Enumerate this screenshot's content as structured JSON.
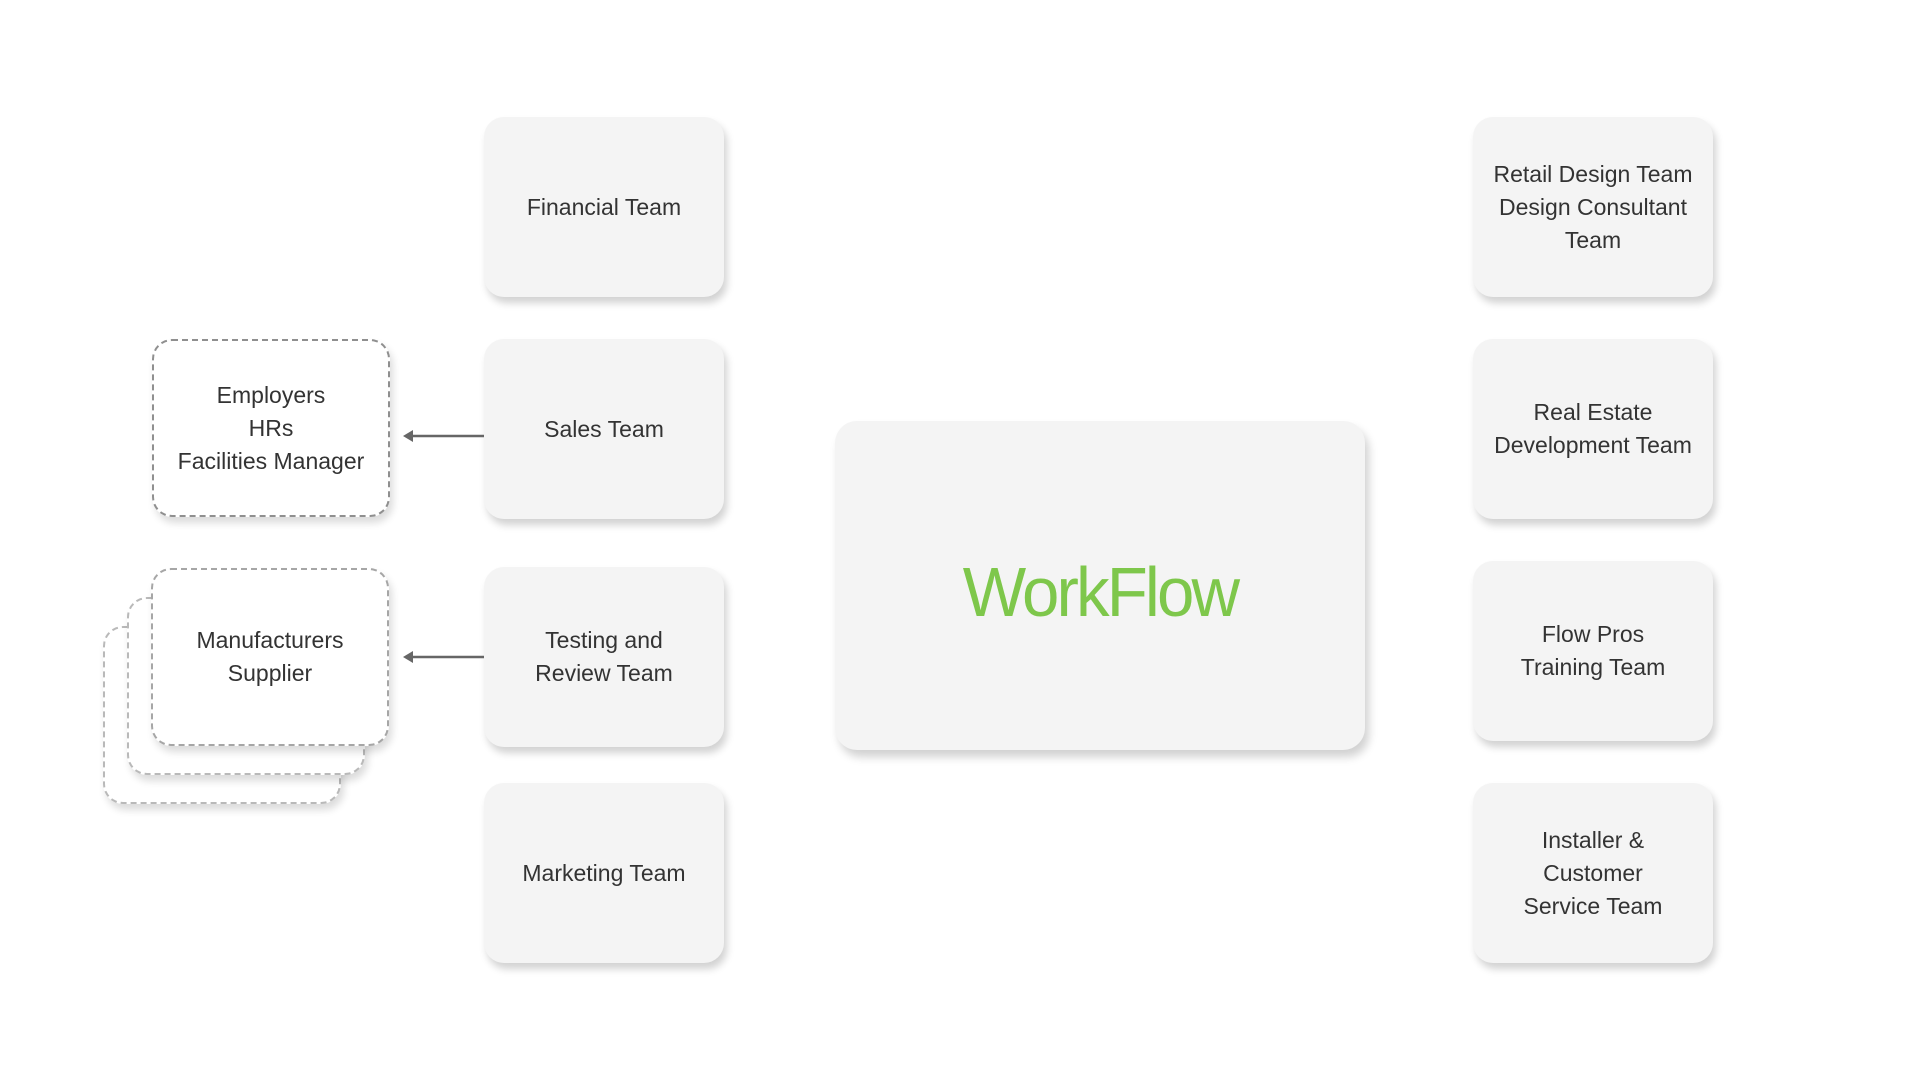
{
  "diagram": {
    "brand": {
      "name": "WorkFlow",
      "color": "#7ec74b"
    },
    "left_teams": [
      {
        "id": "financial",
        "label": "Financial Team"
      },
      {
        "id": "sales",
        "label": "Sales Team"
      },
      {
        "id": "testing",
        "label": "Testing and\nReview Team"
      },
      {
        "id": "marketing",
        "label": "Marketing Team"
      }
    ],
    "right_teams": [
      {
        "id": "retail-design",
        "label": "Retail Design Team\nDesign Consultant\nTeam"
      },
      {
        "id": "real-estate",
        "label": "Real Estate\nDevelopment Team"
      },
      {
        "id": "flow-pros",
        "label": "Flow Pros\nTraining Team"
      },
      {
        "id": "installer",
        "label": "Installer &\nCustomer\nService Team"
      }
    ],
    "external": [
      {
        "id": "employers",
        "label": "Employers\nHRs\nFacilities Manager",
        "stacked": false
      },
      {
        "id": "manufacturers",
        "label": "Manufacturers\nSupplier",
        "stacked": true
      }
    ],
    "connections": [
      {
        "from": "sales",
        "to": "employers",
        "style": "arrow"
      },
      {
        "from": "testing",
        "to": "manufacturers",
        "style": "arrow"
      }
    ],
    "colors": {
      "box_fill": "#f4f4f4",
      "text": "#333333",
      "arrow": "#666666",
      "dashed_border": "#8f8f8f"
    }
  }
}
